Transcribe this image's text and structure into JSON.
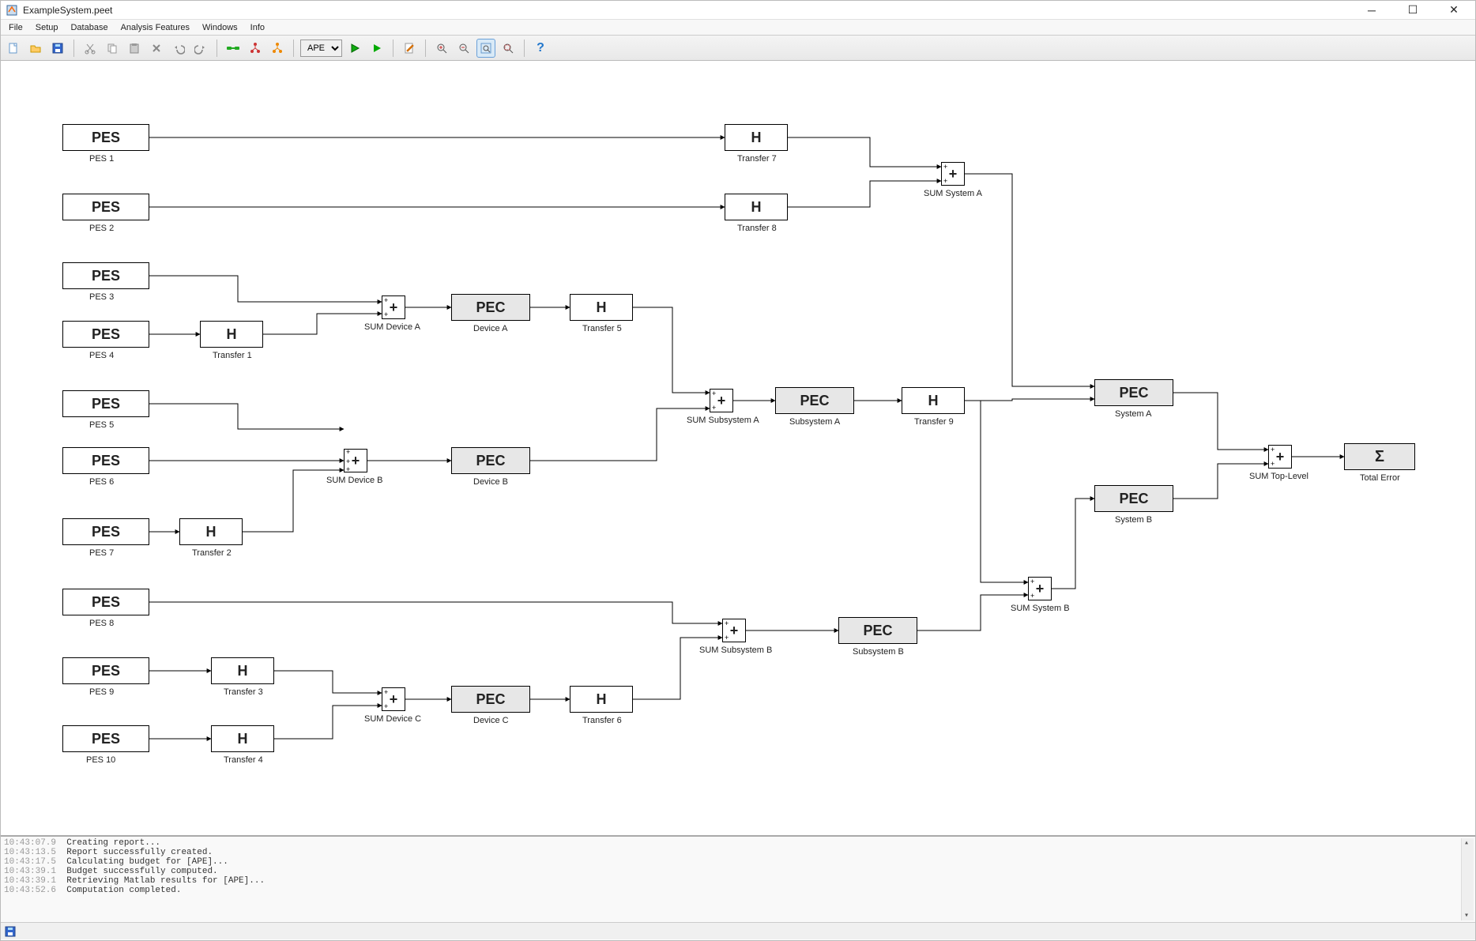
{
  "window": {
    "title": "ExampleSystem.peet"
  },
  "menu": {
    "items": [
      "File",
      "Setup",
      "Database",
      "Analysis Features",
      "Windows",
      "Info"
    ]
  },
  "toolbar": {
    "dropdown_value": "APE",
    "icons": {
      "new": "new-file",
      "open": "open-folder",
      "save": "save-disk",
      "cut": "cut",
      "copy": "copy",
      "paste": "paste",
      "delete": "delete",
      "undo": "undo",
      "redo": "redo",
      "link": "link-green",
      "tree1": "tree-red",
      "tree2": "tree-orange",
      "run1": "play-green",
      "run2": "play-green-filled",
      "edit": "edit-doc",
      "zoom_in": "zoom-in",
      "zoom_out": "zoom-out",
      "zoom_fit": "zoom-fit",
      "zoom_region": "zoom-region",
      "help": "help"
    }
  },
  "blocks": {
    "pes1": {
      "text": "PES",
      "label": "PES 1"
    },
    "pes2": {
      "text": "PES",
      "label": "PES 2"
    },
    "pes3": {
      "text": "PES",
      "label": "PES 3"
    },
    "pes4": {
      "text": "PES",
      "label": "PES 4"
    },
    "pes5": {
      "text": "PES",
      "label": "PES 5"
    },
    "pes6": {
      "text": "PES",
      "label": "PES 6"
    },
    "pes7": {
      "text": "PES",
      "label": "PES 7"
    },
    "pes8": {
      "text": "PES",
      "label": "PES 8"
    },
    "pes9": {
      "text": "PES",
      "label": "PES 9"
    },
    "pes10": {
      "text": "PES",
      "label": "PES 10"
    },
    "h1": {
      "text": "H",
      "label": "Transfer 1"
    },
    "h2": {
      "text": "H",
      "label": "Transfer 2"
    },
    "h3": {
      "text": "H",
      "label": "Transfer 3"
    },
    "h4": {
      "text": "H",
      "label": "Transfer 4"
    },
    "h5": {
      "text": "H",
      "label": "Transfer 5"
    },
    "h6": {
      "text": "H",
      "label": "Transfer 6"
    },
    "h7": {
      "text": "H",
      "label": "Transfer 7"
    },
    "h8": {
      "text": "H",
      "label": "Transfer 8"
    },
    "h9": {
      "text": "H",
      "label": "Transfer 9"
    },
    "sumA": {
      "label": "SUM Device A"
    },
    "sumB": {
      "label": "SUM Device B"
    },
    "sumC": {
      "label": "SUM Device C"
    },
    "sumSubA": {
      "label": "SUM Subsystem A"
    },
    "sumSubB": {
      "label": "SUM Subsystem B"
    },
    "sumSysA": {
      "label": "SUM System A"
    },
    "sumSysB": {
      "label": "SUM System B"
    },
    "sumTop": {
      "label": "SUM Top-Level"
    },
    "pecA": {
      "text": "PEC",
      "label": "Device A"
    },
    "pecB": {
      "text": "PEC",
      "label": "Device B"
    },
    "pecC": {
      "text": "PEC",
      "label": "Device C"
    },
    "pecSubA": {
      "text": "PEC",
      "label": "Subsystem A"
    },
    "pecSubB": {
      "text": "PEC",
      "label": "Subsystem B"
    },
    "pecSysA": {
      "text": "PEC",
      "label": "System A"
    },
    "pecSysB": {
      "text": "PEC",
      "label": "System B"
    },
    "sigma": {
      "text": "Σ",
      "label": "Total Error"
    }
  },
  "console": {
    "lines": [
      {
        "ts": "10:43:07.9",
        "msg": "Creating report..."
      },
      {
        "ts": "10:43:13.5",
        "msg": "Report successfully created."
      },
      {
        "ts": "10:43:17.5",
        "msg": "Calculating budget for [APE]..."
      },
      {
        "ts": "10:43:39.1",
        "msg": "Budget successfully computed."
      },
      {
        "ts": "10:43:39.1",
        "msg": "Retrieving Matlab results for [APE]..."
      },
      {
        "ts": "10:43:52.6",
        "msg": "Computation completed."
      }
    ]
  }
}
